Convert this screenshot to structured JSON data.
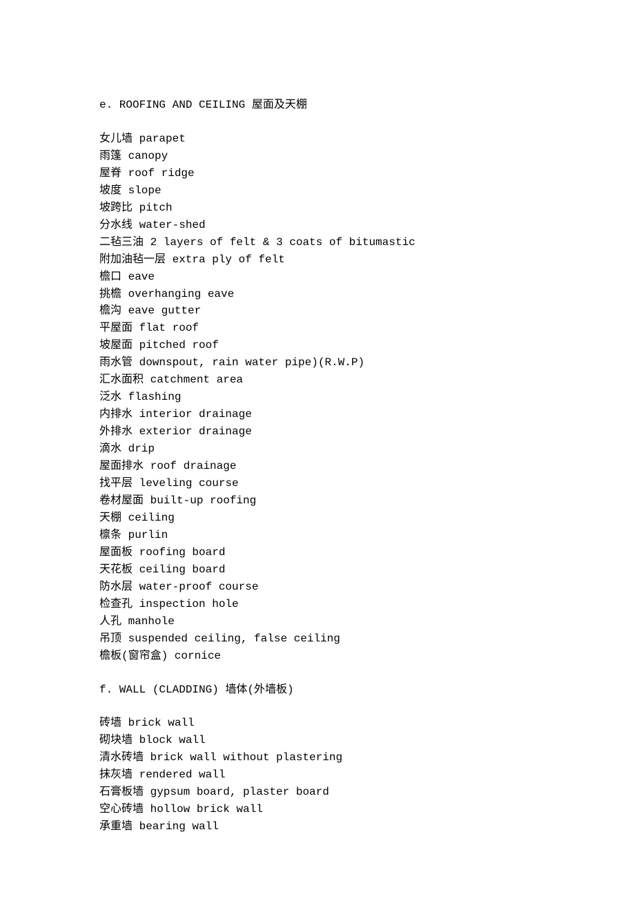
{
  "section_e": {
    "heading": "e. ROOFING AND CEILING 屋面及天棚",
    "items": [
      "女儿墙 parapet",
      "雨篷 canopy",
      "屋脊 roof ridge",
      "坡度 slope",
      "坡跨比 pitch",
      "分水线 water-shed",
      "二毡三油 2 layers of felt & 3 coats of bitumastic",
      "附加油毡一层 extra ply of felt",
      "檐口 eave",
      "挑檐 overhanging eave",
      "檐沟 eave gutter",
      "平屋面 flat roof",
      "坡屋面 pitched roof",
      "雨水管 downspout, rain water pipe)(R.W.P)",
      "汇水面积 catchment area",
      "泛水 flashing",
      "内排水 interior drainage",
      "外排水 exterior drainage",
      "滴水 drip",
      "屋面排水 roof drainage",
      "找平层 leveling course",
      "卷材屋面 built-up roofing",
      "天棚 ceiling",
      "檩条 purlin",
      "屋面板 roofing board",
      "天花板 ceiling board",
      "防水层 water-proof course",
      "检查孔 inspection hole",
      "人孔 manhole",
      "吊顶 suspended ceiling, false ceiling",
      "檐板(窗帘盒) cornice"
    ]
  },
  "section_f": {
    "heading": "f. WALL (CLADDING) 墙体(外墙板)",
    "items": [
      "砖墙 brick wall",
      "砌块墙 block wall",
      "清水砖墙 brick wall without plastering",
      "抹灰墙 rendered wall",
      "石膏板墙 gypsum board, plaster board",
      "空心砖墙 hollow brick wall",
      "承重墙 bearing wall"
    ]
  }
}
